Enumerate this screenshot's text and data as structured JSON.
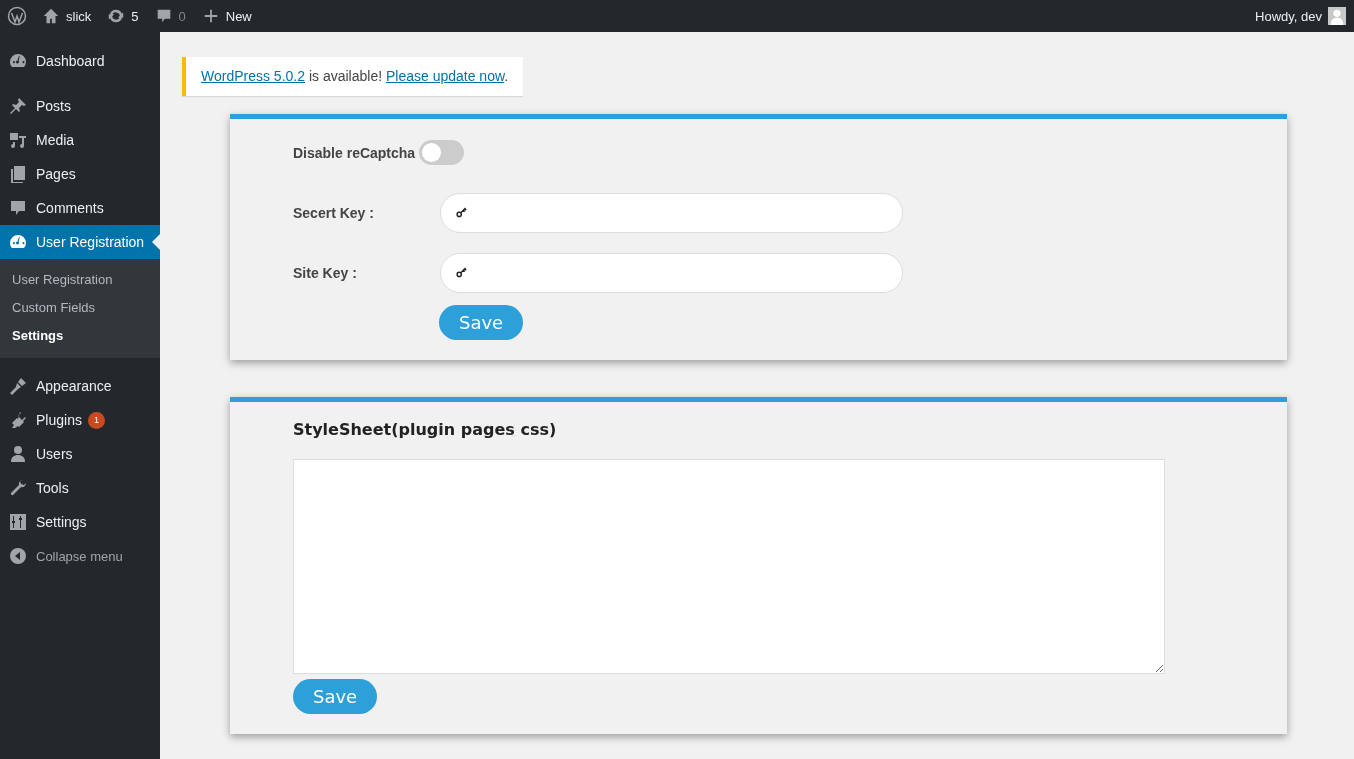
{
  "admin_bar": {
    "site": "slick",
    "updates": "5",
    "comments": "0",
    "new": "New",
    "greeting": "Howdy, dev"
  },
  "sidebar": {
    "items": [
      {
        "kind": "item",
        "label": "Dashboard",
        "selected": false
      },
      {
        "kind": "separator"
      },
      {
        "kind": "item",
        "label": "Posts",
        "selected": false
      },
      {
        "kind": "item",
        "label": "Media",
        "selected": false
      },
      {
        "kind": "item",
        "label": "Pages",
        "selected": false
      },
      {
        "kind": "item",
        "label": "Comments",
        "selected": false
      },
      {
        "kind": "item",
        "label": "User Registration",
        "selected": true,
        "children": [
          {
            "label": "User Registration",
            "selected": false
          },
          {
            "label": "Custom Fields",
            "selected": false
          },
          {
            "label": "Settings",
            "selected": true
          }
        ]
      },
      {
        "kind": "separator"
      },
      {
        "kind": "item",
        "label": "Appearance",
        "selected": false
      },
      {
        "kind": "item",
        "label": "Plugins",
        "selected": false,
        "badge": "1"
      },
      {
        "kind": "item",
        "label": "Users",
        "selected": false
      },
      {
        "kind": "item",
        "label": "Tools",
        "selected": false
      },
      {
        "kind": "item",
        "label": "Settings",
        "selected": false
      },
      {
        "kind": "collapse",
        "label": "Collapse menu"
      }
    ]
  },
  "notice": {
    "link": "WordPress 5.0.2",
    "text": " is available! ",
    "action": "Please update now",
    "end": "."
  },
  "recaptcha_panel": {
    "toggle_label": "Disable reCaptcha",
    "toggle_on": false,
    "fields": [
      {
        "label": "Secert Key :"
      },
      {
        "label": "Site Key :"
      }
    ],
    "button": "Save"
  },
  "stylesheet_panel": {
    "title": "StyleSheet(plugin pages css)",
    "button": "Save"
  }
}
